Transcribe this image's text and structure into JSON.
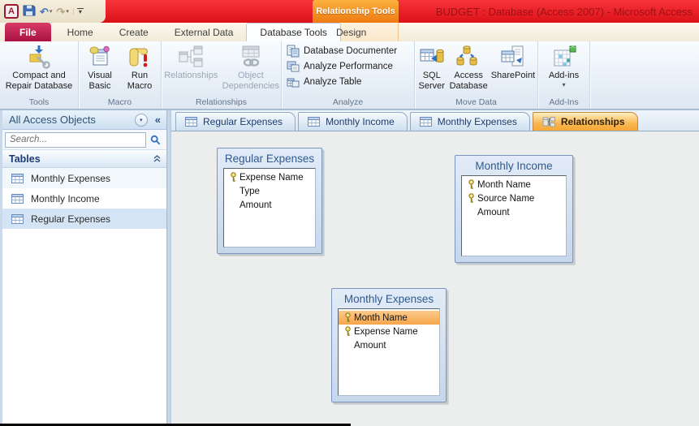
{
  "colors": {
    "titlebar_red": "#e31b1c",
    "contextual_orange": "#f49e26",
    "file_tab_red": "#b81848",
    "active_doc_tab_orange": "#f6a833",
    "selected_field_orange": "#f7a64b",
    "nav_selection_blue": "#d5e4f4"
  },
  "icons": {
    "undo": "↶",
    "redo": "↷",
    "dropdown": "▾",
    "shutter": "«",
    "app_letter": "A"
  },
  "titlebar": {
    "contextual_header": "Relationship Tools",
    "title": "BUDGET : Database (Access 2007) - Microsoft Access"
  },
  "ribbon_tabs": [
    {
      "label": "File"
    },
    {
      "label": "Home"
    },
    {
      "label": "Create"
    },
    {
      "label": "External Data"
    },
    {
      "label": "Database Tools",
      "active": true
    },
    {
      "label": "Design",
      "contextual": true
    }
  ],
  "ribbon": {
    "groups": [
      {
        "label": "Tools",
        "buttons": [
          {
            "label": "Compact and Repair Database"
          }
        ]
      },
      {
        "label": "Macro",
        "buttons": [
          {
            "label": "Visual Basic"
          },
          {
            "label": "Run Macro"
          }
        ]
      },
      {
        "label": "Relationships",
        "buttons": [
          {
            "label": "Relationships",
            "disabled": true
          },
          {
            "label": "Object Dependencies",
            "disabled": true
          }
        ]
      },
      {
        "label": "Analyze",
        "buttons": [
          {
            "label": "Database Documenter"
          },
          {
            "label": "Analyze Performance"
          },
          {
            "label": "Analyze Table"
          }
        ]
      },
      {
        "label": "Move Data",
        "buttons": [
          {
            "label": "SQL Server"
          },
          {
            "label": "Access Database"
          },
          {
            "label": "SharePoint"
          }
        ]
      },
      {
        "label": "Add-Ins",
        "buttons": [
          {
            "label": "Add-ins"
          }
        ]
      }
    ]
  },
  "nav_pane": {
    "header": "All Access Objects",
    "search_placeholder": "Search...",
    "section": "Tables",
    "items": [
      {
        "label": "Monthly Expenses"
      },
      {
        "label": "Monthly Income"
      },
      {
        "label": "Regular Expenses",
        "selected": true
      }
    ]
  },
  "doc_tabs": [
    {
      "label": "Regular Expenses"
    },
    {
      "label": "Monthly Income"
    },
    {
      "label": "Monthly Expenses"
    },
    {
      "label": "Relationships",
      "active": true
    }
  ],
  "diagram": {
    "tables": [
      {
        "title": "Regular Expenses",
        "fields": [
          {
            "name": "Expense Name",
            "key": true
          },
          {
            "name": "Type",
            "key": false
          },
          {
            "name": "Amount",
            "key": false
          }
        ]
      },
      {
        "title": "Monthly Income",
        "fields": [
          {
            "name": "Month Name",
            "key": true
          },
          {
            "name": "Source Name",
            "key": true
          },
          {
            "name": "Amount",
            "key": false
          }
        ]
      },
      {
        "title": "Monthly Expenses",
        "fields": [
          {
            "name": "Month Name",
            "key": true,
            "selected": true
          },
          {
            "name": "Expense Name",
            "key": true
          },
          {
            "name": "Amount",
            "key": false
          }
        ]
      }
    ]
  }
}
